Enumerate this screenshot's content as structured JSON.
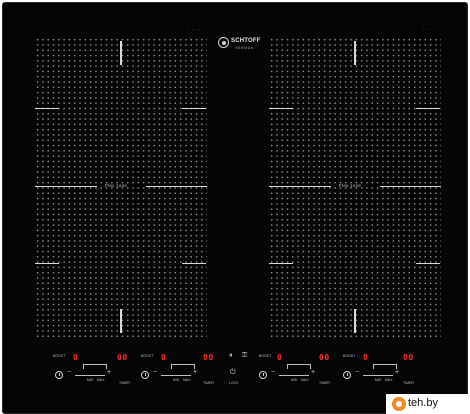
{
  "brand": {
    "name": "SCHTOFF",
    "sub": "HERMAN"
  },
  "corner_marks": "· · ·",
  "zones": {
    "left_label": "Flex zone",
    "right_label": "Flex zone"
  },
  "controls": {
    "left": {
      "group_label": "BOOST",
      "zone1_display": "0",
      "zone1_timer": "00",
      "zone2_label": "BOOST",
      "zone2_display": "0",
      "zone2_timer": "00",
      "mid_label": "MID",
      "max_label": "MAX",
      "timer_label": "TIMER"
    },
    "center": {
      "lock_label": "LOCK",
      "power_icon": "power-icon",
      "pause_icon": "pause-icon"
    },
    "right": {
      "group_label": "BOOST",
      "zone3_display": "0",
      "zone3_timer": "00",
      "zone4_label": "BOOST",
      "zone4_display": "0",
      "zone4_timer": "00",
      "mid_label": "MID",
      "max_label": "MAX",
      "timer_label": "TIMER"
    }
  },
  "watermark": {
    "text": "teh.by",
    "color": "#f08a1d"
  }
}
